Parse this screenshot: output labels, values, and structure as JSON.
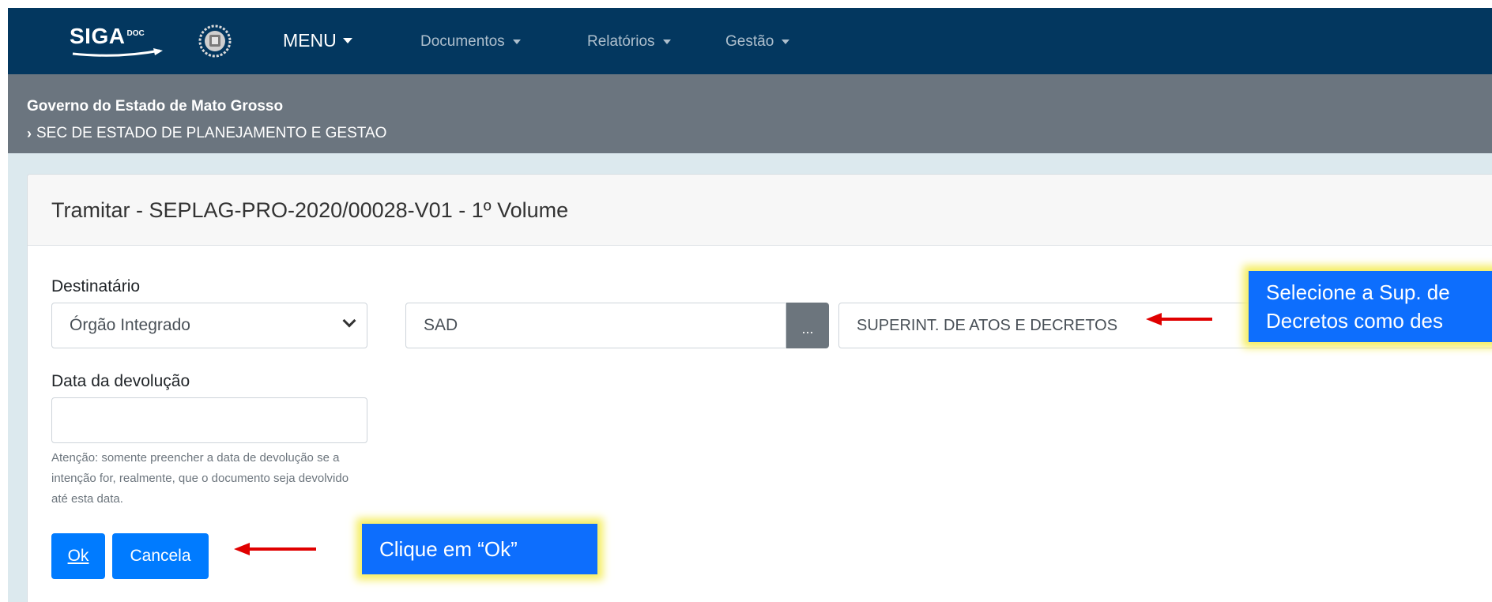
{
  "navbar": {
    "logo": "SIGA",
    "logo_sup": "DOC",
    "menu_label": "MENU",
    "items": [
      {
        "label": "Documentos"
      },
      {
        "label": "Relatórios"
      },
      {
        "label": "Gestão"
      }
    ]
  },
  "breadcrumb": {
    "title": "Governo do Estado de Mato Grosso",
    "sub": "SEC DE ESTADO DE PLANEJAMENTO E GESTAO"
  },
  "form": {
    "title": "Tramitar - SEPLAG-PRO-2020/00028-V01 - 1º Volume",
    "destinatario_label": "Destinatário",
    "destinatario_type": "Órgão Integrado",
    "sigla_value": "SAD",
    "lookup_button": "...",
    "orgao_name": "SUPERINT. DE ATOS E DECRETOS",
    "data_label": "Data da devolução",
    "data_value": "",
    "help_text": "Atenção: somente preencher a data de devolução se a intenção for, realmente, que o documento seja devolvido até esta data.",
    "ok_button": "Ok",
    "cancel_button": "Cancela"
  },
  "callouts": {
    "ok_hint": "Clique em  “Ok”",
    "dest_line1": "Selecione  a Sup. de",
    "dest_line2": "Decretos como des"
  },
  "colors": {
    "navbar": "#03375f",
    "breadcrumb_bar": "#6b757f",
    "primary": "#007bff",
    "callout": "#0d6efd",
    "highlight": "#f5ee62",
    "arrow": "#e00000"
  }
}
